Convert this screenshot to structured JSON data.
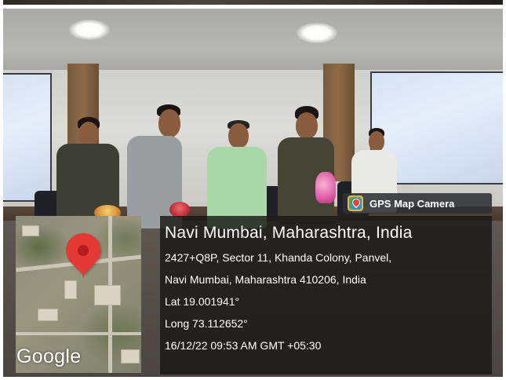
{
  "app_badge": {
    "icon": "gps-map-camera-app-icon",
    "label": "GPS Map Camera"
  },
  "location": {
    "title": "Navi Mumbai, Maharashtra, India",
    "address_line_1": "2427+Q8P, Sector 11, Khanda Colony, Panvel,",
    "address_line_2": "Navi Mumbai, Maharashtra 410206, India",
    "latitude": "Lat 19.001941°",
    "longitude": "Long 73.112652°",
    "datetime": "16/12/22 09:53 AM GMT +05:30"
  },
  "map": {
    "icon": "map-pin-icon",
    "provider_label": "Google",
    "pin_color": "#e53935"
  },
  "colors": {
    "panel_background": "#1a1816",
    "text": "#ffffff"
  }
}
